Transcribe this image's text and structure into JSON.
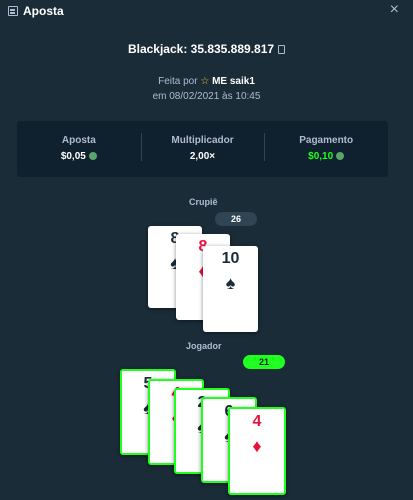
{
  "header": {
    "title": "Aposta",
    "close": "×"
  },
  "game": {
    "id": "Blackjack: 35.835.889.817",
    "made_by_prefix": "Feita por",
    "username": "ME saik1",
    "made_on": "em 08/02/2021 às 10:45"
  },
  "stats": {
    "bet_label": "Aposta",
    "bet_value": "$0,05",
    "mult_label": "Multiplicador",
    "mult_value": "2,00×",
    "payout_label": "Pagamento",
    "payout_value": "$0,10"
  },
  "dealer": {
    "label": "Crupiê",
    "total": "26",
    "cards": [
      {
        "rank": "8",
        "suit": "♠",
        "color": "black"
      },
      {
        "rank": "8",
        "suit": "♦",
        "color": "red"
      },
      {
        "rank": "10",
        "suit": "♠",
        "color": "black"
      }
    ]
  },
  "player": {
    "label": "Jogador",
    "total": "21",
    "cards": [
      {
        "rank": "5",
        "suit": "♠",
        "color": "black"
      },
      {
        "rank": "4",
        "suit": "♦",
        "color": "red"
      },
      {
        "rank": "2",
        "suit": "♠",
        "color": "black"
      },
      {
        "rank": "6",
        "suit": "♠",
        "color": "black"
      },
      {
        "rank": "4",
        "suit": "♦",
        "color": "red"
      }
    ]
  },
  "colors": {
    "background": "#1a2c38",
    "panel": "#0f212e",
    "win": "#1fff20",
    "red_suit": "#e9113c"
  }
}
